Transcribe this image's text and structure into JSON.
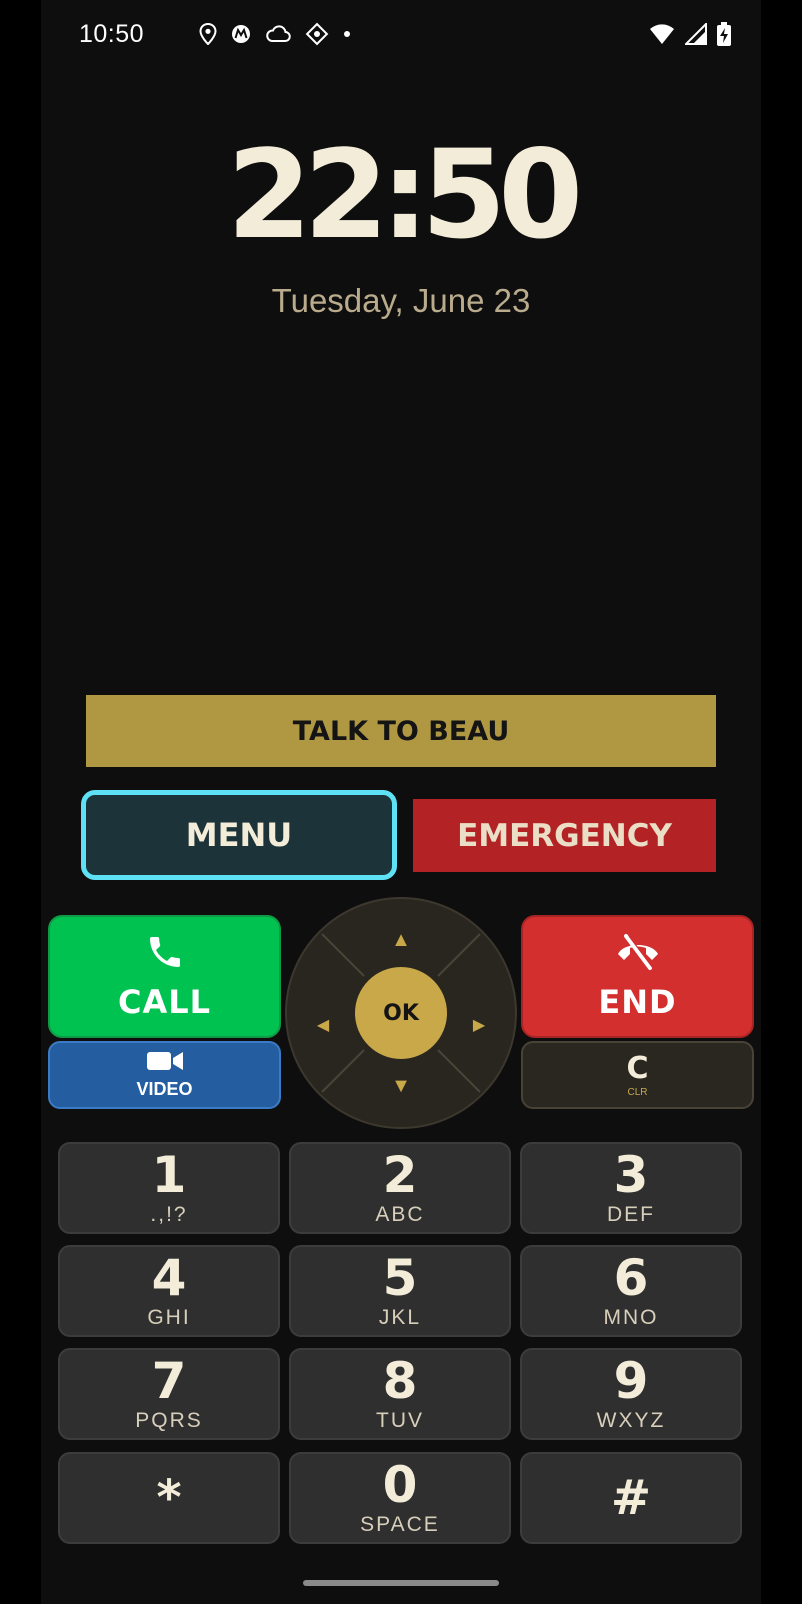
{
  "status_bar": {
    "time": "10:50",
    "left_icons": [
      "location-icon",
      "motorola-icon",
      "cloud-icon",
      "app-icon",
      "dot-icon"
    ],
    "right_icons": [
      "wifi-icon",
      "signal-icon",
      "battery-charging-icon"
    ]
  },
  "clock": {
    "time": "22:50",
    "date": "Tuesday, June 23"
  },
  "buttons": {
    "talk": "TALK TO BEAU",
    "menu": "MENU",
    "emergency": "EMERGENCY",
    "call": "CALL",
    "end": "END",
    "video": "VIDEO",
    "clear_main": "C",
    "clear_sub": "CLR",
    "ok": "OK"
  },
  "dpad_arrows": {
    "up": "▲",
    "down": "▼",
    "left": "◀",
    "right": "▶"
  },
  "keypad": [
    {
      "digit": "1",
      "letters": ".,!?"
    },
    {
      "digit": "2",
      "letters": "ABC"
    },
    {
      "digit": "3",
      "letters": "DEF"
    },
    {
      "digit": "4",
      "letters": "GHI"
    },
    {
      "digit": "5",
      "letters": "JKL"
    },
    {
      "digit": "6",
      "letters": "MNO"
    },
    {
      "digit": "7",
      "letters": "PQRS"
    },
    {
      "digit": "8",
      "letters": "TUV"
    },
    {
      "digit": "9",
      "letters": "WXYZ"
    },
    {
      "digit": "*",
      "letters": ""
    },
    {
      "digit": "0",
      "letters": "SPACE"
    },
    {
      "digit": "#",
      "letters": ""
    }
  ],
  "colors": {
    "talk_bg": "#b09843",
    "menu_bg": "#1b3339",
    "menu_focus": "#5ee0f5",
    "emergency_bg": "#b32326",
    "call_bg": "#00c251",
    "end_bg": "#d32f2f",
    "video_bg": "#245ea1",
    "ok_bg": "#c9a84a"
  }
}
